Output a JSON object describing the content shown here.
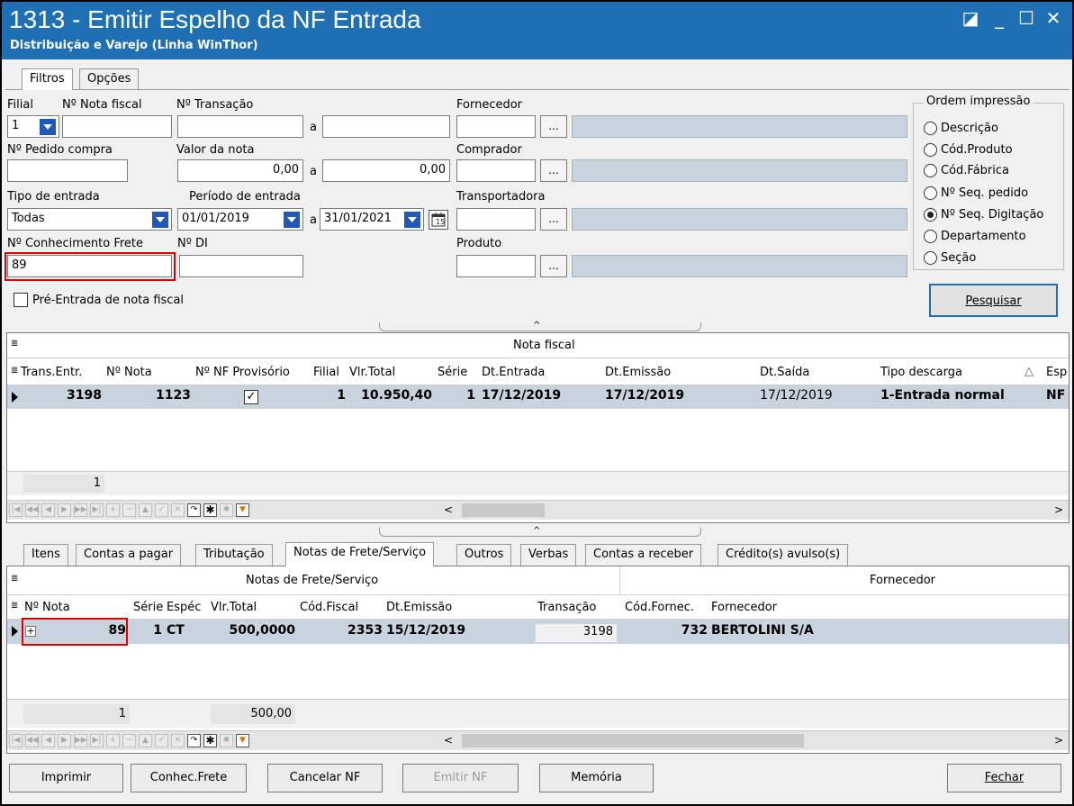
{
  "window": {
    "title": "1313 - Emitir Espelho da NF Entrada",
    "subtitle": "Distribuição e Varejo (Linha WinThor)",
    "min": "_",
    "max": "☐",
    "close": "✕",
    "restore": "◪"
  },
  "tabs_top": [
    {
      "label": "Filtros"
    },
    {
      "label": "Opções"
    }
  ],
  "filters": {
    "filial_label": "Filial",
    "filial_value": "1",
    "nota_fiscal_label": "Nº Nota fiscal",
    "transacao_label": "Nº Transação",
    "a": "a",
    "fornecedor_label": "Fornecedor",
    "pedido_label": "Nº Pedido compra",
    "valor_label": "Valor da nota",
    "valor_from": "0,00",
    "valor_to": "0,00",
    "comprador_label": "Comprador",
    "tipo_label": "Tipo de entrada",
    "tipo_value": "Todas",
    "periodo_label": "Período de entrada",
    "periodo_from": "01/01/2019",
    "periodo_to": "31/01/2021",
    "transportadora_label": "Transportadora",
    "conhecimento_label": "Nº Conhecimento Frete",
    "conhecimento_value": "89",
    "di_label": "Nº DI",
    "produto_label": "Produto",
    "pre_entrada_label": "Pré-Entrada de nota fiscal",
    "dots": "..."
  },
  "ordem": {
    "label": "Ordem impressão",
    "options": [
      "Descrição",
      "Cód.Produto",
      "Cód.Fábrica",
      "Nº Seq. pedido",
      "Nº Seq. Digitação",
      "Departamento",
      "Seção"
    ],
    "selected": "Nº Seq. Digitação"
  },
  "pesquisar": "Pesquisar",
  "grid1": {
    "band": "Nota fiscal",
    "columns": [
      "Trans.Entr.",
      "Nº Nota",
      "Nº NF Provisório",
      "Filial",
      "Vlr.Total",
      "Série",
      "Dt.Entrada",
      "Dt.Emissão",
      "Dt.Saída",
      "Tipo descarga",
      "Esp"
    ],
    "row": {
      "trans": "3198",
      "nota": "1123",
      "filial": "1",
      "vlr": "10.950,40",
      "serie": "1",
      "entrada": "17/12/2019",
      "emissao": "17/12/2019",
      "saida": "17/12/2019",
      "tipo": "1-Entrada normal",
      "esp": "NF"
    },
    "footer_count": "1"
  },
  "tabs_bottom": [
    {
      "label": "Itens"
    },
    {
      "label": "Contas a pagar"
    },
    {
      "label": "Tributação"
    },
    {
      "label": "Notas de Frete/Serviço"
    },
    {
      "label": "Outros"
    },
    {
      "label": "Verbas"
    },
    {
      "label": "Contas a receber"
    },
    {
      "label": "Crédito(s) avulso(s)"
    }
  ],
  "grid2": {
    "band1": "Notas de Frete/Serviço",
    "band2": "Fornecedor",
    "columns": [
      "Nº Nota",
      "Série",
      "Espéc",
      "Vlr.Total",
      "Cód.Fiscal",
      "Dt.Emissão",
      "Transação",
      "Cód.Fornec.",
      "Fornecedor"
    ],
    "row": {
      "nota": "89",
      "serie": "1",
      "especie": "CT",
      "vlr": "500,0000",
      "cfop": "2353",
      "emissao": "15/12/2019",
      "transacao": "3198",
      "codforn": "732",
      "fornecedor": "BERTOLINI S/A"
    },
    "footer_count": "1",
    "footer_total": "500,00"
  },
  "buttons": {
    "imprimir": "Imprimir",
    "conhec": "Conhec.Frete",
    "cancelar": "Cancelar NF",
    "emitir": "Emitir NF",
    "memoria": "Memória",
    "fechar": "Fechar"
  }
}
